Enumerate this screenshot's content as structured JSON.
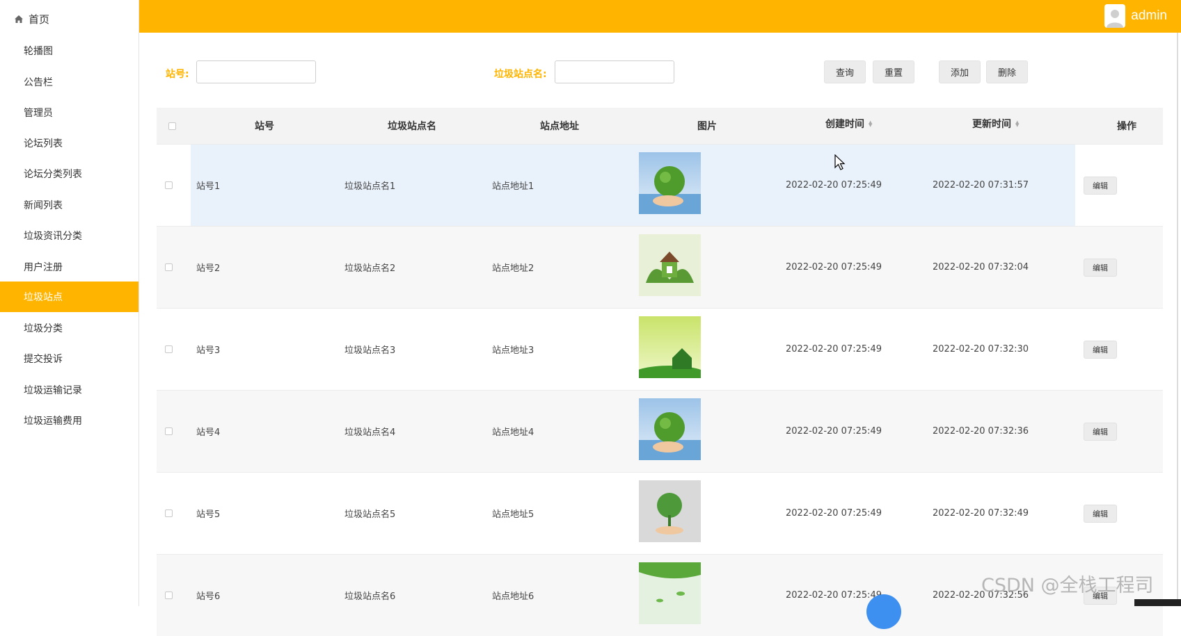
{
  "sidebar": {
    "home_label": "首页",
    "items": [
      {
        "label": "轮播图"
      },
      {
        "label": "公告栏"
      },
      {
        "label": "管理员"
      },
      {
        "label": "论坛列表"
      },
      {
        "label": "论坛分类列表"
      },
      {
        "label": "新闻列表"
      },
      {
        "label": "垃圾资讯分类"
      },
      {
        "label": "用户注册"
      },
      {
        "label": "垃圾站点",
        "active": true
      },
      {
        "label": "垃圾分类"
      },
      {
        "label": "提交投诉"
      },
      {
        "label": "垃圾运输记录"
      },
      {
        "label": "垃圾运输费用"
      }
    ]
  },
  "header": {
    "username": "admin",
    "accent_color": "#ffb400"
  },
  "search": {
    "station_no_label": "站号:",
    "station_no_value": "",
    "station_name_label": "垃圾站点名:",
    "station_name_value": ""
  },
  "buttons": {
    "query": "查询",
    "reset": "重置",
    "add": "添加",
    "delete": "删除"
  },
  "table": {
    "headers": {
      "station_no": "站号",
      "station_name": "垃圾站点名",
      "address": "站点地址",
      "image": "图片",
      "created": "创建时间",
      "updated": "更新时间",
      "actions": "操作"
    },
    "edit_label": "编辑",
    "rows": [
      {
        "station_no": "站号1",
        "station_name": "垃圾站点名1",
        "address": "站点地址1",
        "image_icon": "globe-in-hand-image",
        "created": "2022-02-20 07:25:49",
        "updated": "2022-02-20 07:31:57"
      },
      {
        "station_no": "站号2",
        "station_name": "垃圾站点名2",
        "address": "站点地址2",
        "image_icon": "house-in-hands-image",
        "created": "2022-02-20 07:25:49",
        "updated": "2022-02-20 07:32:04"
      },
      {
        "station_no": "站号3",
        "station_name": "垃圾站点名3",
        "address": "站点地址3",
        "image_icon": "grass-house-image",
        "created": "2022-02-20 07:25:49",
        "updated": "2022-02-20 07:32:30"
      },
      {
        "station_no": "站号4",
        "station_name": "垃圾站点名4",
        "address": "站点地址4",
        "image_icon": "globe-in-hand-image",
        "created": "2022-02-20 07:25:49",
        "updated": "2022-02-20 07:32:36"
      },
      {
        "station_no": "站号5",
        "station_name": "垃圾站点名5",
        "address": "站点地址5",
        "image_icon": "tree-in-hand-image",
        "created": "2022-02-20 07:25:49",
        "updated": "2022-02-20 07:32:49"
      },
      {
        "station_no": "站号6",
        "station_name": "垃圾站点名6",
        "address": "站点地址6",
        "image_icon": "leaves-image",
        "created": "2022-02-20 07:25:49",
        "updated": "2022-02-20 07:32:56"
      }
    ]
  },
  "watermark": "CSDN @全栈工程司"
}
